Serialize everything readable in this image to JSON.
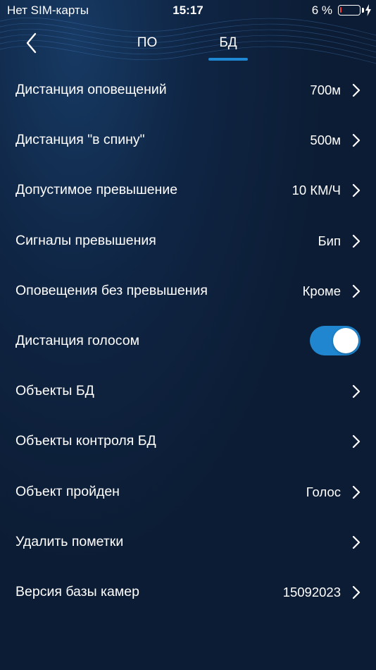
{
  "status_bar": {
    "carrier": "Нет SIM-карты",
    "time": "15:17",
    "battery_text": "6 %",
    "battery_level": 0.06,
    "battery_color": "#ff3b30"
  },
  "header": {
    "back_icon": "chevron-left-icon",
    "tabs": [
      {
        "label": "ПО",
        "active": false
      },
      {
        "label": "БД",
        "active": true
      }
    ],
    "accent_color": "#1e88d4"
  },
  "settings": [
    {
      "label": "Дистанция оповещений",
      "value": "700м",
      "control": "chevron"
    },
    {
      "label": "Дистанция \"в спину\"",
      "value": "500м",
      "control": "chevron"
    },
    {
      "label": "Допустимое превышение",
      "value": "10 КМ/Ч",
      "control": "chevron"
    },
    {
      "label": "Сигналы превышения",
      "value": "Бип",
      "control": "chevron"
    },
    {
      "label": "Оповещения без превышения",
      "value": "Кроме",
      "control": "chevron"
    },
    {
      "label": "Дистанция голосом",
      "value": "",
      "control": "toggle",
      "toggle_on": true
    },
    {
      "label": "Объекты БД",
      "value": "",
      "control": "chevron"
    },
    {
      "label": "Объекты контроля БД",
      "value": "",
      "control": "chevron"
    },
    {
      "label": "Объект пройден",
      "value": "Голос",
      "control": "chevron"
    },
    {
      "label": "Удалить пометки",
      "value": "",
      "control": "chevron"
    },
    {
      "label": "Версия базы камер",
      "value": "15092023",
      "control": "chevron"
    }
  ]
}
